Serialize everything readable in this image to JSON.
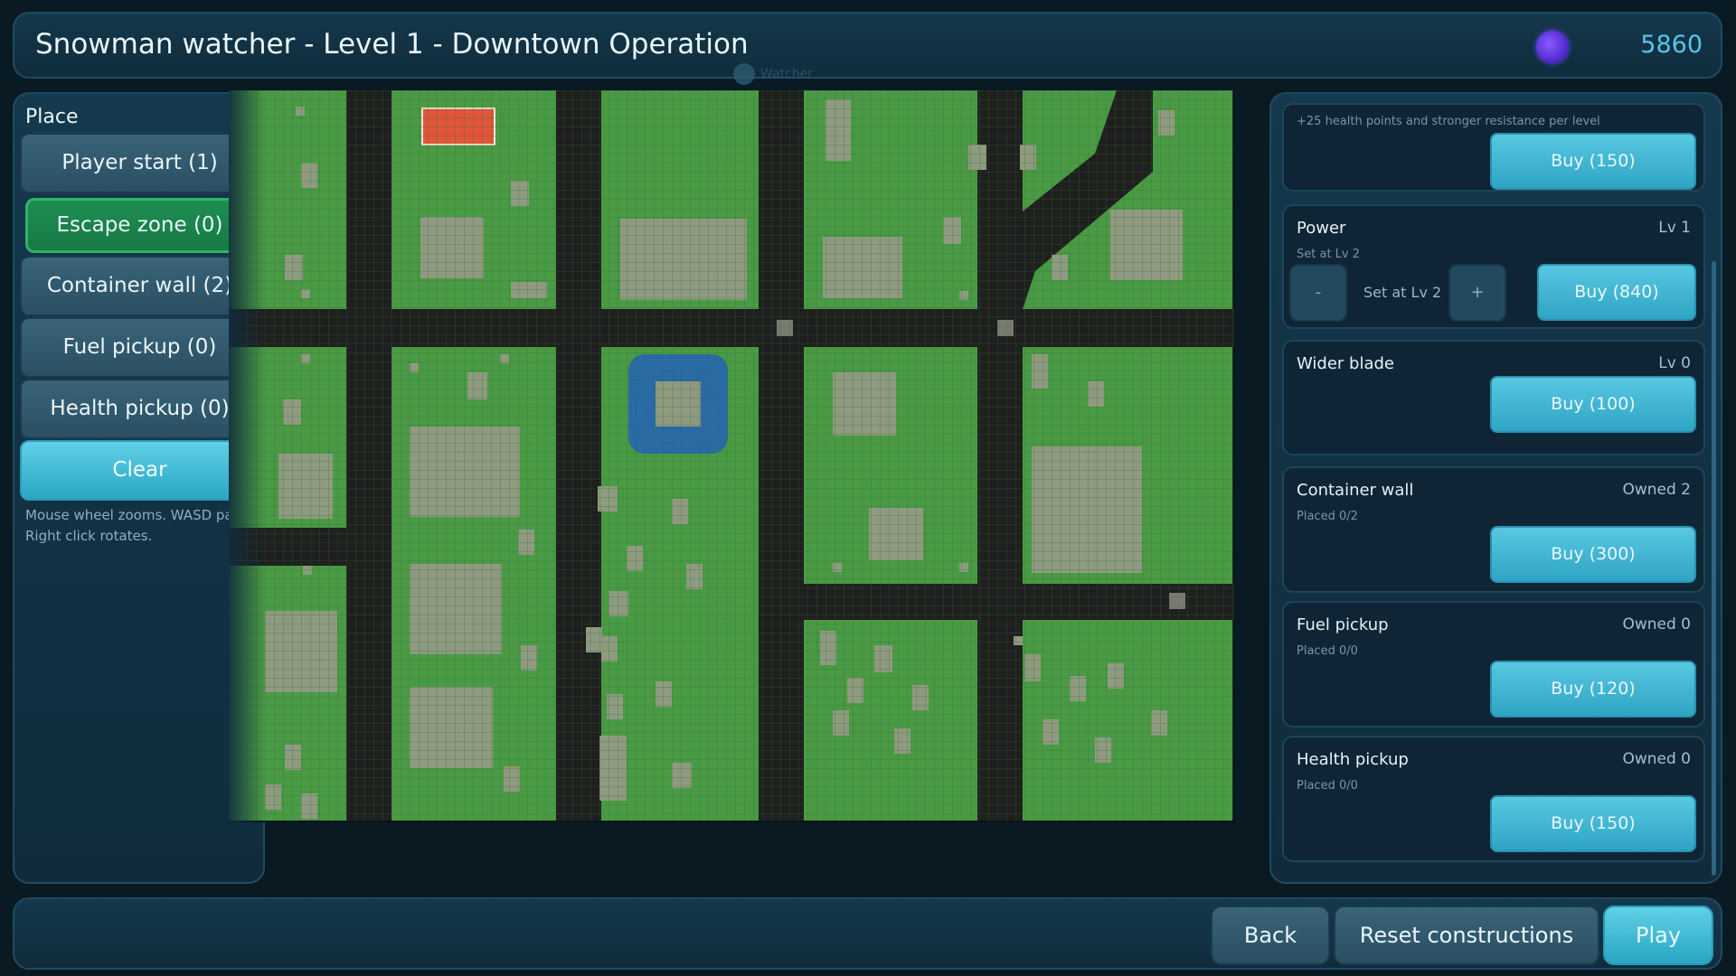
{
  "header": {
    "title": "Snowman watcher - Level 1 - Downtown Operation",
    "currency_icon": "coin-icon",
    "currency_value": "5860",
    "watermark": "Watcher"
  },
  "place_panel": {
    "title": "Place",
    "buttons": [
      {
        "label": "Player start (1)",
        "active": false
      },
      {
        "label": "Escape zone (0)",
        "active": true
      },
      {
        "label": "Container wall (2)",
        "active": false
      },
      {
        "label": "Fuel pickup (0)",
        "active": false
      },
      {
        "label": "Health pickup (0)",
        "active": false
      }
    ],
    "clear_label": "Clear",
    "hint": "Mouse wheel zooms. WASD pans. Right click rotates."
  },
  "shop": {
    "items": [
      {
        "title": "",
        "sub": "+25 health points and stronger resistance per level",
        "right": "",
        "buy": "Buy (150)"
      },
      {
        "title": "Power",
        "right": "Lv 1",
        "sub": "Set at Lv 2",
        "step_minus": "-",
        "step_label": "Set at Lv 2",
        "step_plus": "+",
        "buy": "Buy (840)"
      },
      {
        "title": "Wider blade",
        "right": "Lv 0",
        "sub": "",
        "buy": "Buy (100)"
      },
      {
        "title": "Container wall",
        "right": "Owned 2",
        "sub": "Placed 0/2",
        "buy": "Buy (300)"
      },
      {
        "title": "Fuel pickup",
        "right": "Owned 0",
        "sub": "Placed 0/0",
        "buy": "Buy (120)"
      },
      {
        "title": "Health pickup",
        "right": "Owned 0",
        "sub": "Placed 0/0",
        "buy": "Buy (150)"
      }
    ]
  },
  "footer": {
    "back": "Back",
    "reset": "Reset constructions",
    "play": "Play"
  },
  "colors": {
    "grass": "#4a9a45",
    "road": "#1f1f1f",
    "building": "#8f9a80",
    "water": "#2a6aa8",
    "player_start": "#e2553a",
    "accent": "#3fb6d6"
  }
}
